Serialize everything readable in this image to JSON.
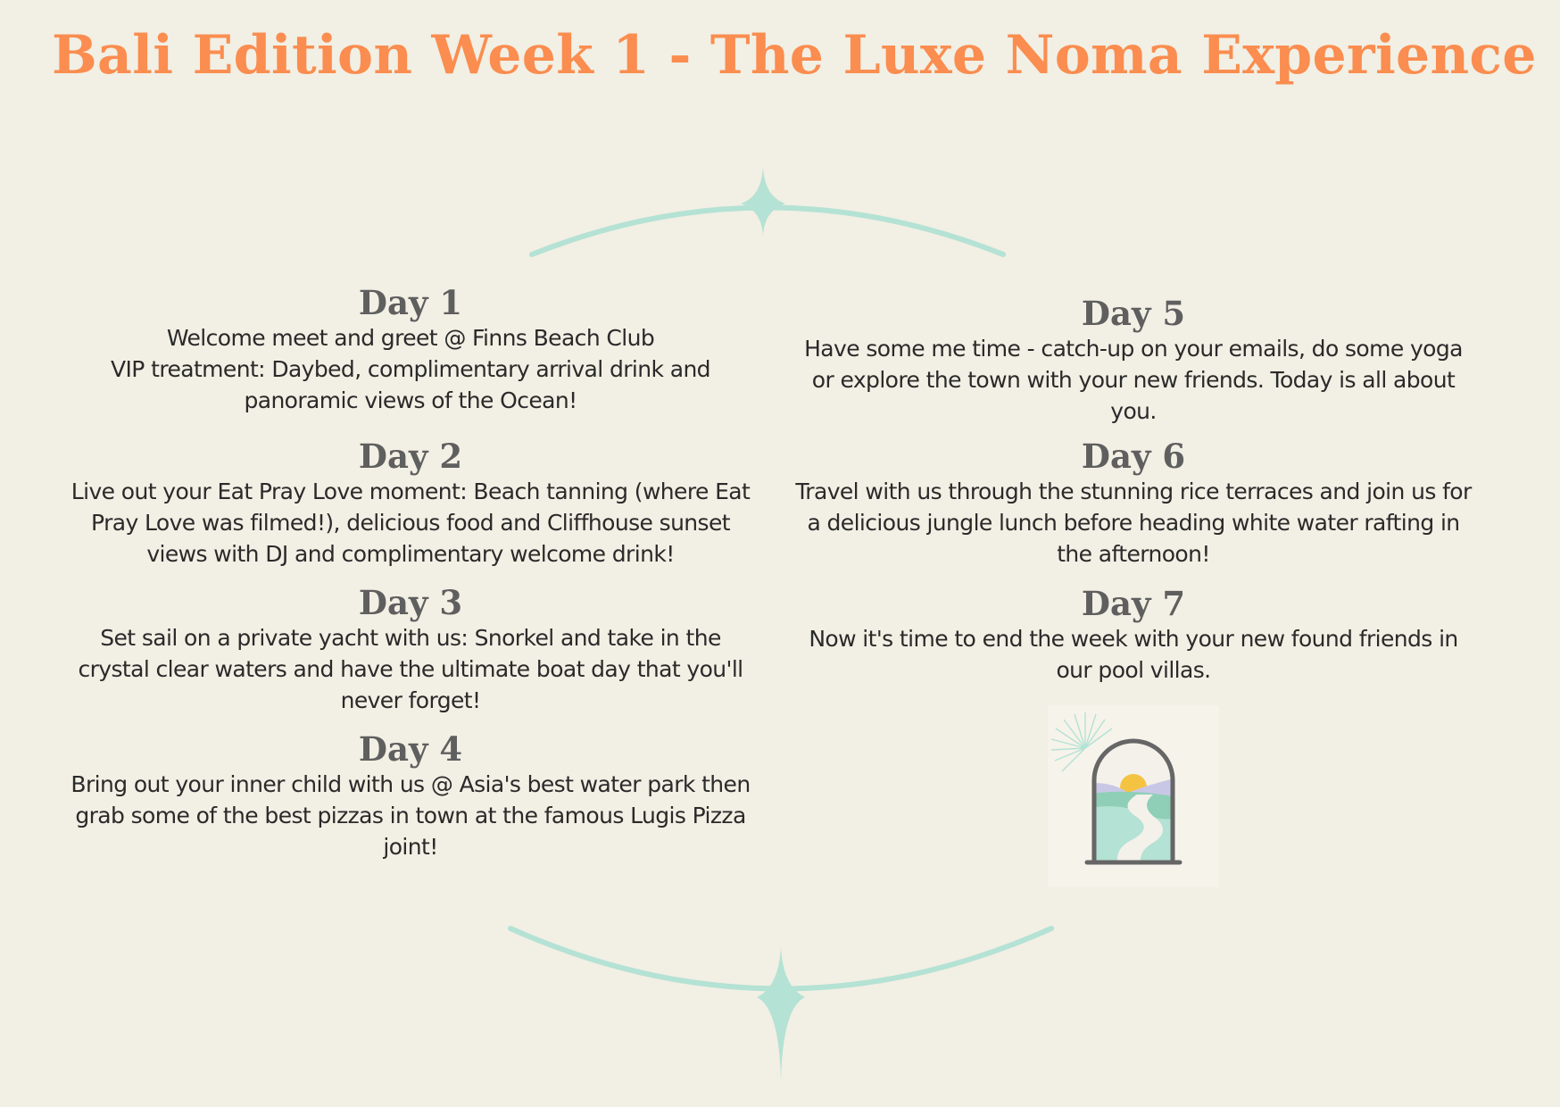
{
  "title": "Bali Edition Week 1 - The Luxe Noma Experience",
  "colors": {
    "background": "#f2efe4",
    "title": "#fa8d4f",
    "heading": "#5f5f5f",
    "body_text": "#2a2a2a",
    "ornament": "#b4e2d4"
  },
  "days": [
    {
      "heading": "Day 1",
      "text": "Welcome meet and greet @ Finns Beach Club\nVIP treatment: Daybed, complimentary arrival drink and panoramic views of the Ocean!"
    },
    {
      "heading": "Day 2",
      "text": "Live out your Eat Pray Love moment: Beach tanning (where Eat Pray Love was filmed!), delicious food and Cliffhouse sunset views with DJ and complimentary welcome drink!"
    },
    {
      "heading": "Day 3",
      "text": "Set sail on a private yacht with us: Snorkel and take in the crystal clear waters and have the ultimate boat day that you'll never forget!"
    },
    {
      "heading": "Day 4",
      "text": "Bring out your inner child with us @ Asia's best water park then grab some of the best pizzas in town at the famous Lugis Pizza joint!"
    },
    {
      "heading": "Day 5",
      "text": "Have some me time - catch-up on your emails, do some yoga or explore the town with your new friends. Today is all about you."
    },
    {
      "heading": "Day 6",
      "text": "Travel with us through the stunning rice terraces and join us for a delicious jungle lunch before heading white water rafting in the afternoon!"
    },
    {
      "heading": "Day 7",
      "text": "Now it's time to end the week with your new found friends in our pool villas."
    }
  ],
  "icons": {
    "top_ornament": "sparkle-arc-icon",
    "bottom_ornament": "sparkle-arc-icon",
    "illustration": "arch-window-sunset-icon"
  }
}
